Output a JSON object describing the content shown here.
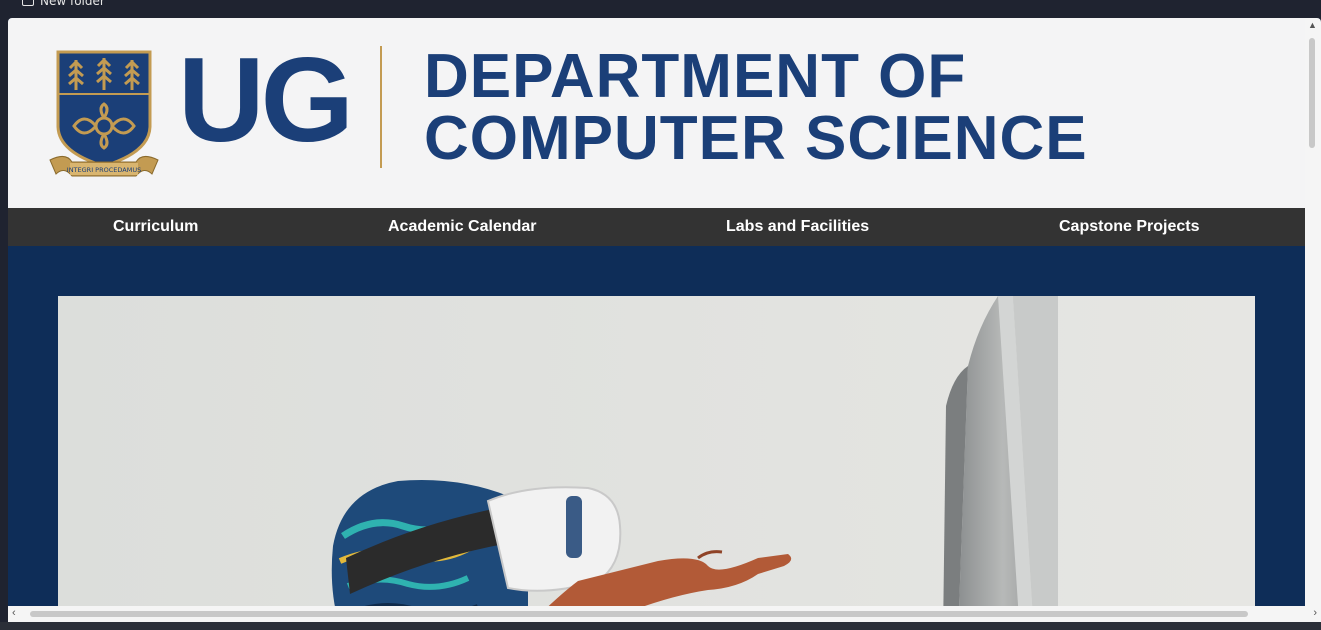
{
  "bookmark_bar": {
    "folder_label": "New folder"
  },
  "header": {
    "logo_text": "UG",
    "crest_motto": "INTEGRI PROCEDAMUS",
    "department_line1": "DEPARTMENT OF",
    "department_line2": "COMPUTER SCIENCE"
  },
  "nav": {
    "items": [
      {
        "label": "Curriculum"
      },
      {
        "label": "Academic Calendar"
      },
      {
        "label": "Labs and Facilities"
      },
      {
        "label": "Capstone Projects"
      }
    ]
  },
  "colors": {
    "brand_blue": "#1b3f78",
    "page_navy": "#0e2d58",
    "gold": "#c39b52",
    "nav_bg": "#333333"
  },
  "hero": {
    "image": "person-with-vr-headset-pointing-at-monitor"
  }
}
